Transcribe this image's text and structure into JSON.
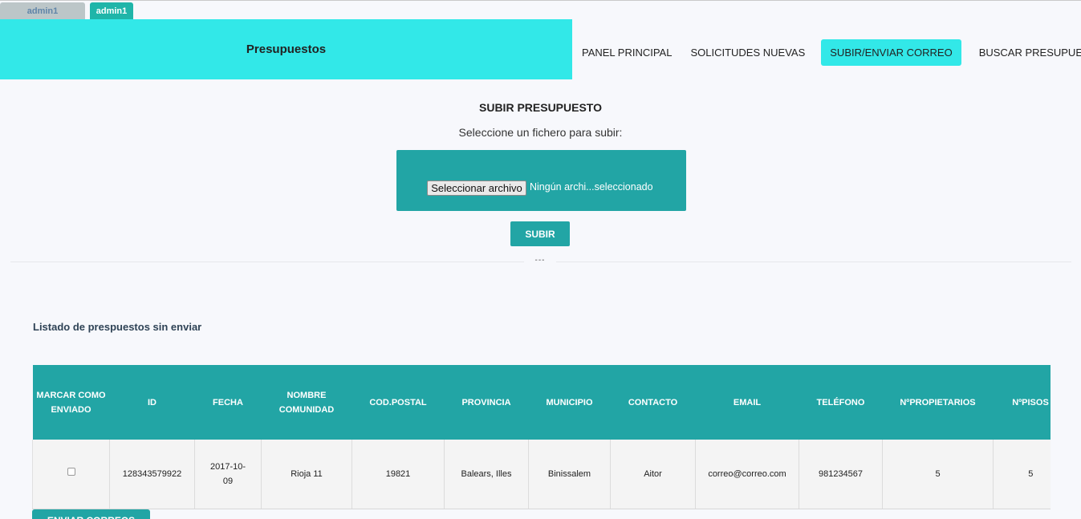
{
  "user_tabs": [
    "admin1",
    "admin1"
  ],
  "header": {
    "title": "Presupuestos"
  },
  "nav": {
    "items": [
      "PANEL PRINCIPAL",
      "SOLICITUDES NUEVAS",
      "SUBIR/ENVIAR CORREO",
      "BUSCAR PRESUPUESTO"
    ],
    "active_index": 2
  },
  "upload": {
    "heading": "SUBIR PRESUPUESTO",
    "instruction": "Seleccione un fichero para subir:",
    "file_button": "Seleccionar archivo",
    "file_status": "Ningún archi...seleccionado",
    "submit_label": "SUBIR",
    "divider_mark": "---"
  },
  "list": {
    "title": "Listado de prespuestos sin enviar",
    "columns": [
      "MARCAR COMO ENVIADO",
      "ID",
      "FECHA",
      "NOMBRE COMUNIDAD",
      "COD.POSTAL",
      "PROVINCIA",
      "MUNICIPIO",
      "CONTACTO",
      "EMAIL",
      "TELÉFONO",
      "NºPROPIETARIOS",
      "NºPISOS"
    ],
    "rows": [
      {
        "checked": false,
        "id": "128343579922",
        "fecha": "2017-10-09",
        "nombre_comunidad": "Rioja 11",
        "cod_postal": "19821",
        "provincia": "Balears, Illes",
        "municipio": "Binissalem",
        "contacto": "Aitor",
        "email": "correo@correo.com",
        "telefono": "981234567",
        "propietarios": "5",
        "pisos": "5"
      }
    ],
    "send_button": "ENVIAR CORREOS"
  },
  "colors": {
    "accent_teal": "#22a5a5",
    "accent_cyan": "#32e8e8"
  }
}
